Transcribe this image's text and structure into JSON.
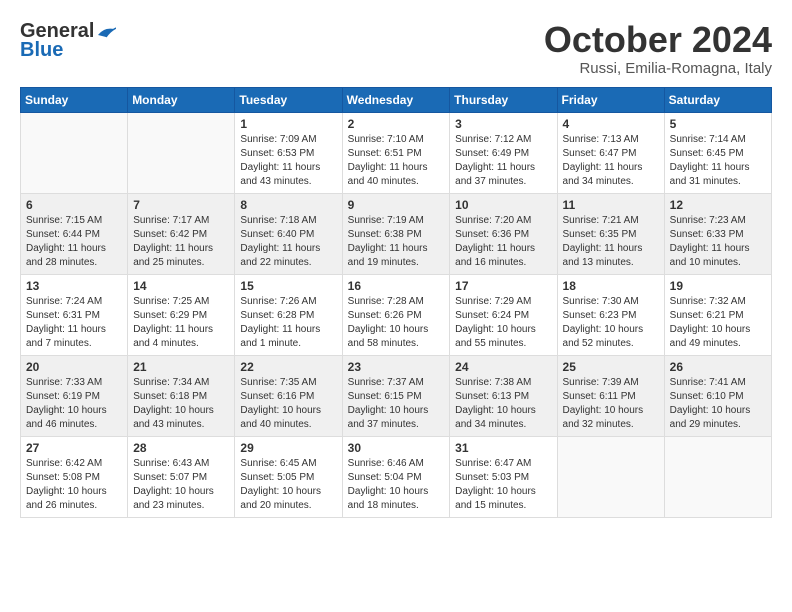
{
  "header": {
    "logo_line1": "General",
    "logo_line2": "Blue",
    "month": "October 2024",
    "location": "Russi, Emilia-Romagna, Italy"
  },
  "weekdays": [
    "Sunday",
    "Monday",
    "Tuesday",
    "Wednesday",
    "Thursday",
    "Friday",
    "Saturday"
  ],
  "weeks": [
    [
      {
        "day": "",
        "sunrise": "",
        "sunset": "",
        "daylight": ""
      },
      {
        "day": "",
        "sunrise": "",
        "sunset": "",
        "daylight": ""
      },
      {
        "day": "1",
        "sunrise": "Sunrise: 7:09 AM",
        "sunset": "Sunset: 6:53 PM",
        "daylight": "Daylight: 11 hours and 43 minutes."
      },
      {
        "day": "2",
        "sunrise": "Sunrise: 7:10 AM",
        "sunset": "Sunset: 6:51 PM",
        "daylight": "Daylight: 11 hours and 40 minutes."
      },
      {
        "day": "3",
        "sunrise": "Sunrise: 7:12 AM",
        "sunset": "Sunset: 6:49 PM",
        "daylight": "Daylight: 11 hours and 37 minutes."
      },
      {
        "day": "4",
        "sunrise": "Sunrise: 7:13 AM",
        "sunset": "Sunset: 6:47 PM",
        "daylight": "Daylight: 11 hours and 34 minutes."
      },
      {
        "day": "5",
        "sunrise": "Sunrise: 7:14 AM",
        "sunset": "Sunset: 6:45 PM",
        "daylight": "Daylight: 11 hours and 31 minutes."
      }
    ],
    [
      {
        "day": "6",
        "sunrise": "Sunrise: 7:15 AM",
        "sunset": "Sunset: 6:44 PM",
        "daylight": "Daylight: 11 hours and 28 minutes."
      },
      {
        "day": "7",
        "sunrise": "Sunrise: 7:17 AM",
        "sunset": "Sunset: 6:42 PM",
        "daylight": "Daylight: 11 hours and 25 minutes."
      },
      {
        "day": "8",
        "sunrise": "Sunrise: 7:18 AM",
        "sunset": "Sunset: 6:40 PM",
        "daylight": "Daylight: 11 hours and 22 minutes."
      },
      {
        "day": "9",
        "sunrise": "Sunrise: 7:19 AM",
        "sunset": "Sunset: 6:38 PM",
        "daylight": "Daylight: 11 hours and 19 minutes."
      },
      {
        "day": "10",
        "sunrise": "Sunrise: 7:20 AM",
        "sunset": "Sunset: 6:36 PM",
        "daylight": "Daylight: 11 hours and 16 minutes."
      },
      {
        "day": "11",
        "sunrise": "Sunrise: 7:21 AM",
        "sunset": "Sunset: 6:35 PM",
        "daylight": "Daylight: 11 hours and 13 minutes."
      },
      {
        "day": "12",
        "sunrise": "Sunrise: 7:23 AM",
        "sunset": "Sunset: 6:33 PM",
        "daylight": "Daylight: 11 hours and 10 minutes."
      }
    ],
    [
      {
        "day": "13",
        "sunrise": "Sunrise: 7:24 AM",
        "sunset": "Sunset: 6:31 PM",
        "daylight": "Daylight: 11 hours and 7 minutes."
      },
      {
        "day": "14",
        "sunrise": "Sunrise: 7:25 AM",
        "sunset": "Sunset: 6:29 PM",
        "daylight": "Daylight: 11 hours and 4 minutes."
      },
      {
        "day": "15",
        "sunrise": "Sunrise: 7:26 AM",
        "sunset": "Sunset: 6:28 PM",
        "daylight": "Daylight: 11 hours and 1 minute."
      },
      {
        "day": "16",
        "sunrise": "Sunrise: 7:28 AM",
        "sunset": "Sunset: 6:26 PM",
        "daylight": "Daylight: 10 hours and 58 minutes."
      },
      {
        "day": "17",
        "sunrise": "Sunrise: 7:29 AM",
        "sunset": "Sunset: 6:24 PM",
        "daylight": "Daylight: 10 hours and 55 minutes."
      },
      {
        "day": "18",
        "sunrise": "Sunrise: 7:30 AM",
        "sunset": "Sunset: 6:23 PM",
        "daylight": "Daylight: 10 hours and 52 minutes."
      },
      {
        "day": "19",
        "sunrise": "Sunrise: 7:32 AM",
        "sunset": "Sunset: 6:21 PM",
        "daylight": "Daylight: 10 hours and 49 minutes."
      }
    ],
    [
      {
        "day": "20",
        "sunrise": "Sunrise: 7:33 AM",
        "sunset": "Sunset: 6:19 PM",
        "daylight": "Daylight: 10 hours and 46 minutes."
      },
      {
        "day": "21",
        "sunrise": "Sunrise: 7:34 AM",
        "sunset": "Sunset: 6:18 PM",
        "daylight": "Daylight: 10 hours and 43 minutes."
      },
      {
        "day": "22",
        "sunrise": "Sunrise: 7:35 AM",
        "sunset": "Sunset: 6:16 PM",
        "daylight": "Daylight: 10 hours and 40 minutes."
      },
      {
        "day": "23",
        "sunrise": "Sunrise: 7:37 AM",
        "sunset": "Sunset: 6:15 PM",
        "daylight": "Daylight: 10 hours and 37 minutes."
      },
      {
        "day": "24",
        "sunrise": "Sunrise: 7:38 AM",
        "sunset": "Sunset: 6:13 PM",
        "daylight": "Daylight: 10 hours and 34 minutes."
      },
      {
        "day": "25",
        "sunrise": "Sunrise: 7:39 AM",
        "sunset": "Sunset: 6:11 PM",
        "daylight": "Daylight: 10 hours and 32 minutes."
      },
      {
        "day": "26",
        "sunrise": "Sunrise: 7:41 AM",
        "sunset": "Sunset: 6:10 PM",
        "daylight": "Daylight: 10 hours and 29 minutes."
      }
    ],
    [
      {
        "day": "27",
        "sunrise": "Sunrise: 6:42 AM",
        "sunset": "Sunset: 5:08 PM",
        "daylight": "Daylight: 10 hours and 26 minutes."
      },
      {
        "day": "28",
        "sunrise": "Sunrise: 6:43 AM",
        "sunset": "Sunset: 5:07 PM",
        "daylight": "Daylight: 10 hours and 23 minutes."
      },
      {
        "day": "29",
        "sunrise": "Sunrise: 6:45 AM",
        "sunset": "Sunset: 5:05 PM",
        "daylight": "Daylight: 10 hours and 20 minutes."
      },
      {
        "day": "30",
        "sunrise": "Sunrise: 6:46 AM",
        "sunset": "Sunset: 5:04 PM",
        "daylight": "Daylight: 10 hours and 18 minutes."
      },
      {
        "day": "31",
        "sunrise": "Sunrise: 6:47 AM",
        "sunset": "Sunset: 5:03 PM",
        "daylight": "Daylight: 10 hours and 15 minutes."
      },
      {
        "day": "",
        "sunrise": "",
        "sunset": "",
        "daylight": ""
      },
      {
        "day": "",
        "sunrise": "",
        "sunset": "",
        "daylight": ""
      }
    ]
  ]
}
